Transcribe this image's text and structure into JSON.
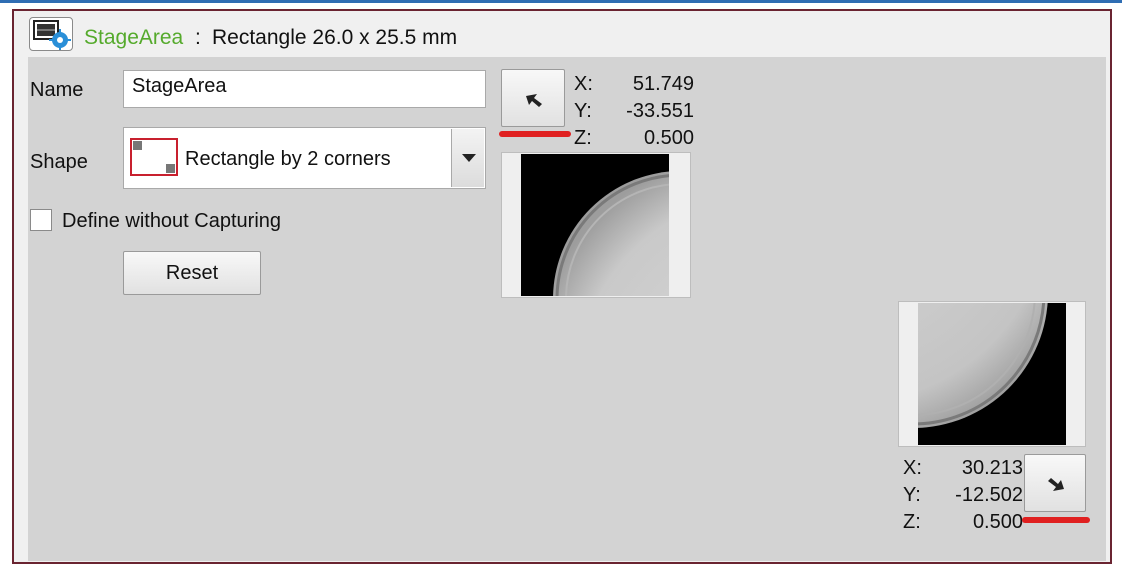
{
  "header": {
    "icon": "stage-area-settings-icon",
    "title": "StageArea",
    "separator": ":",
    "description": "Rectangle 26.0 x 25.5 mm"
  },
  "form": {
    "name_label": "Name",
    "name_value": "StageArea",
    "shape_label": "Shape",
    "shape_value": "Rectangle by 2 corners",
    "define_checkbox_label": "Define without Capturing",
    "define_checkbox_checked": false,
    "reset_label": "Reset"
  },
  "corner1": {
    "x_label": "X:",
    "x_value": "51.749",
    "y_label": "Y:",
    "y_value": "-33.551",
    "z_label": "Z:",
    "z_value": "0.500",
    "move_icon": "move-to-corner-up-left-icon"
  },
  "corner2": {
    "x_label": "X:",
    "x_value": "30.213",
    "y_label": "Y:",
    "y_value": "-12.502",
    "z_label": "Z:",
    "z_value": "0.500",
    "move_icon": "move-to-corner-down-right-icon"
  },
  "colors": {
    "title_green": "#55aa2c",
    "frame_border": "#6a2431",
    "panel_bg": "#d3d3d3",
    "annotation_red": "#e02020",
    "shape_icon_red": "#c8202e"
  }
}
